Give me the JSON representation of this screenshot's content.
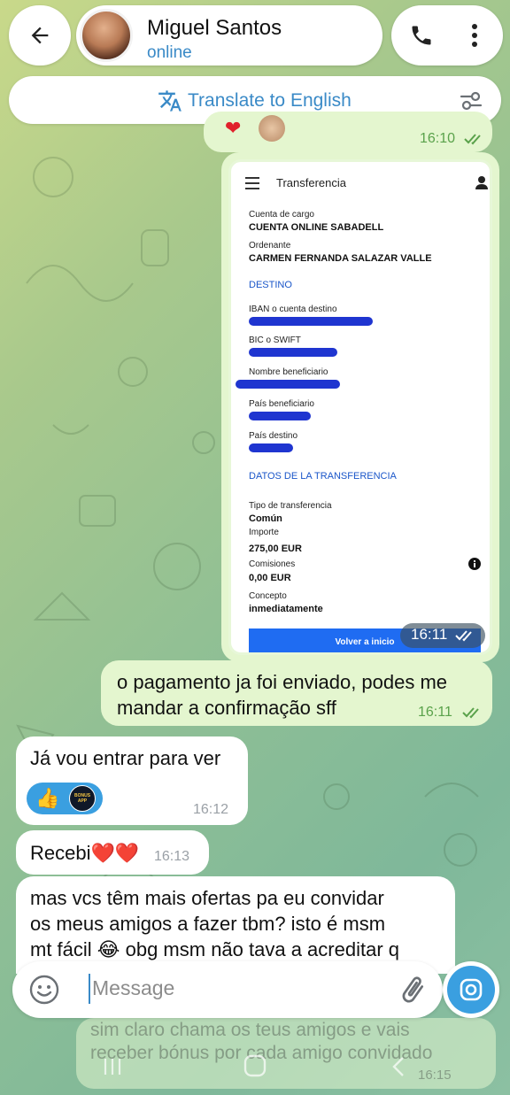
{
  "header": {
    "contact_name": "Miguel Santos",
    "contact_status": "online",
    "translate_label": "Translate to English"
  },
  "messages": {
    "top_time": "16:10",
    "shot_time": "16:11",
    "out1_text_line1": "o pagamento ja foi enviado, podes me",
    "out1_text_line2": "mandar a confirmação sff",
    "out1_time": "16:11",
    "in1_text": "Já vou entrar para ver",
    "in1_time": "16:12",
    "in1_sticker_label": "BONUS APP",
    "in2_text": "Recebi❤️❤️",
    "in2_time": "16:13",
    "in3_line1": "mas vcs têm mais ofertas pa eu convidar",
    "in3_line2": "os meus amigos a fazer tbm? isto é msm",
    "in3_line3": "mt fácil 😂 obg msm não tava a acreditar q",
    "faded_line1": "sim claro chama os teus amigos e vais",
    "faded_line2": "receber bónus por cada amigo convidado",
    "faded_time": "16:15"
  },
  "transfer_screenshot": {
    "title": "Transferencia",
    "cuenta_label": "Cuenta de cargo",
    "cuenta_value": "CUENTA ONLINE SABADELL",
    "ordenante_label": "Ordenante",
    "ordenante_value": "CARMEN FERNANDA SALAZAR VALLE",
    "destino_section": "DESTINO",
    "iban_label": "IBAN o cuenta destino",
    "bic_label": "BIC o SWIFT",
    "beneficiario_label": "Nombre beneficiario",
    "pais_benef_label": "País beneficiario",
    "pais_destino_label": "País destino",
    "datos_section": "DATOS DE LA TRANSFERENCIA",
    "tipo_label": "Tipo de transferencia",
    "tipo_value": "Común",
    "importe_label": "Importe",
    "importe_value": "275,00 EUR",
    "comisiones_label": "Comisiones",
    "comisiones_value": "0,00 EUR",
    "concepto_label": "Concepto",
    "concepto_value": "inmediatamente",
    "button_label": "Volver a inicio"
  },
  "composer": {
    "placeholder": "Message"
  },
  "colors": {
    "accent": "#3a8ac7",
    "outgoing_bubble": "#e4f6cf",
    "incoming_bubble": "#ffffff",
    "check_green": "#5aa24b"
  }
}
